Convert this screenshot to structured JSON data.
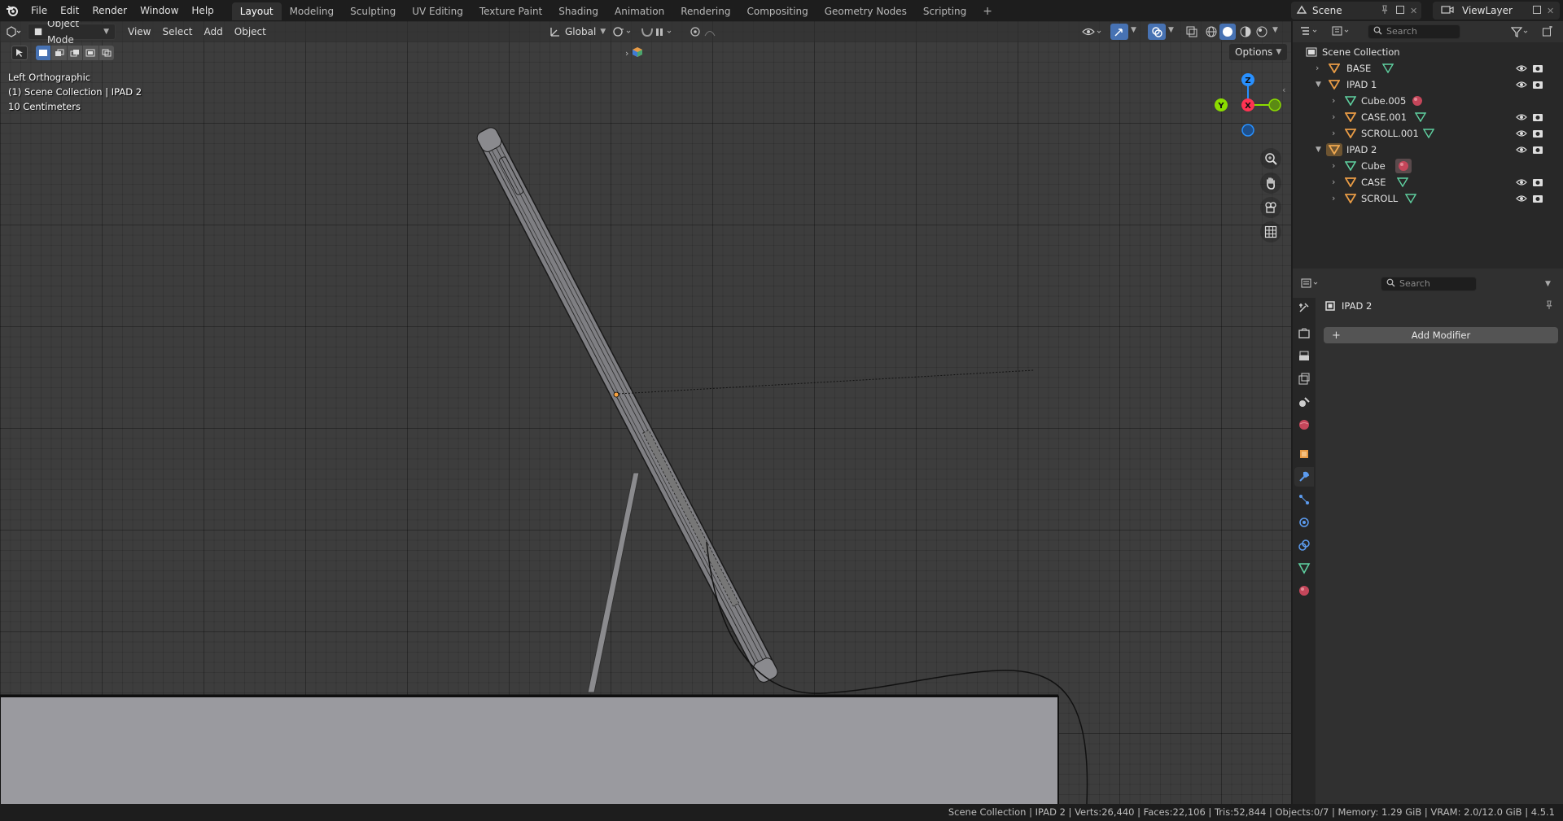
{
  "menu": [
    "File",
    "Edit",
    "Render",
    "Window",
    "Help"
  ],
  "workspaces": [
    "Layout",
    "Modeling",
    "Sculpting",
    "UV Editing",
    "Texture Paint",
    "Shading",
    "Animation",
    "Rendering",
    "Compositing",
    "Geometry Nodes",
    "Scripting"
  ],
  "active_workspace": "Layout",
  "scene_name": "Scene",
  "view_layer": "ViewLayer",
  "viewport": {
    "mode": "Object Mode",
    "menus": [
      "View",
      "Select",
      "Add",
      "Object"
    ],
    "transform_orientation": "Global",
    "options_label": "Options",
    "overlay_view": "Left Orthographic",
    "overlay_collection": "(1) Scene Collection | IPAD 2",
    "overlay_scale": "10 Centimeters",
    "gizmo_axes": {
      "z": "Z",
      "y": "Y",
      "x": "X"
    }
  },
  "outliner": {
    "search_placeholder": "Search",
    "root": "Scene Collection",
    "items": [
      {
        "name": "BASE",
        "depth": 0,
        "expanded": false
      },
      {
        "name": "IPAD 1",
        "depth": 0,
        "expanded": true
      },
      {
        "name": "Cube.005",
        "depth": 1,
        "expanded": false
      },
      {
        "name": "CASE.001",
        "depth": 1,
        "expanded": false
      },
      {
        "name": "SCROLL.001",
        "depth": 1,
        "expanded": false
      },
      {
        "name": "IPAD 2",
        "depth": 0,
        "expanded": true
      },
      {
        "name": "Cube",
        "depth": 1,
        "expanded": false
      },
      {
        "name": "CASE",
        "depth": 1,
        "expanded": false
      },
      {
        "name": "SCROLL",
        "depth": 1,
        "expanded": false
      }
    ]
  },
  "properties": {
    "search_placeholder": "Search",
    "object_name": "IPAD 2",
    "add_modifier_label": "Add Modifier"
  },
  "status": "Scene Collection | IPAD 2 | Verts:26,440 | Faces:22,106 | Tris:52,844 | Objects:0/7 | Memory: 1.29 GiB | VRAM: 2.0/12.0 GiB | 4.5.1",
  "colors": {
    "accent": "#4772b3",
    "axis_x": "#ff3352",
    "axis_y": "#8bdc00",
    "axis_z": "#2890ff",
    "object_orange": "#e89b45",
    "mesh_green": "#5fd0a0"
  }
}
